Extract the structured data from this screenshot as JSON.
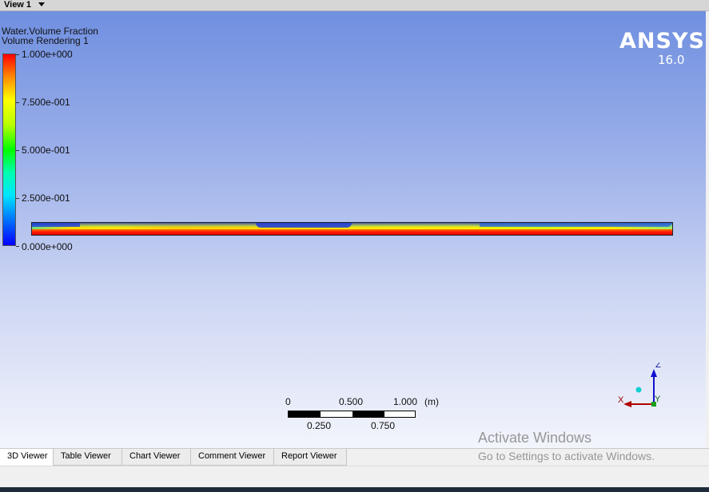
{
  "view": {
    "title": "View 1"
  },
  "legend": {
    "title": "Water.Volume Fraction",
    "subtitle": "Volume Rendering 1",
    "ticks": [
      "1.000e+000",
      "7.500e-001",
      "5.000e-001",
      "2.500e-001",
      "0.000e+000"
    ]
  },
  "branding": {
    "name": "ANSYS",
    "version": "16.0"
  },
  "scale": {
    "top_labels": [
      "0",
      "0.500",
      "1.000"
    ],
    "unit": "(m)",
    "bottom_labels": [
      "0.250",
      "0.750"
    ]
  },
  "axes": {
    "z": "Z",
    "x": "X",
    "y": "Y"
  },
  "watermark": {
    "title": "Activate Windows",
    "subtitle": "Go to Settings to activate Windows."
  },
  "tabs": [
    {
      "label": "3D Viewer",
      "active": true
    },
    {
      "label": "Table Viewer",
      "active": false
    },
    {
      "label": "Chart Viewer",
      "active": false
    },
    {
      "label": "Comment Viewer",
      "active": false
    },
    {
      "label": "Report Viewer",
      "active": false
    }
  ],
  "colors": {
    "background_top": "#6f8fe0",
    "background_bottom": "#f3f5fc",
    "colormap": [
      "#ff0000",
      "#ffff00",
      "#00ff00",
      "#00e5ff",
      "#0000ff"
    ]
  }
}
